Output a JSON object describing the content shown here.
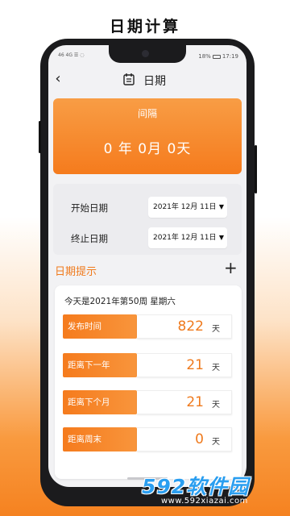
{
  "promo_title": "日期计算",
  "status_bar": {
    "left": "46 4G ☰ ◌",
    "battery": "18%",
    "time": "17:19"
  },
  "header": {
    "title": "日期",
    "back_icon": "back-chevron-icon",
    "title_icon": "calendar-icon"
  },
  "interval": {
    "label": "间隔",
    "value": "0 年 0月 0天"
  },
  "dates": {
    "start_label": "开始日期",
    "start_value": "2021年 12月 11日",
    "end_label": "终止日期",
    "end_value": "2021年 12月 11日"
  },
  "tips": {
    "title": "日期提示",
    "add_icon": "plus-icon",
    "today": "今天是2021年第50周  星期六",
    "items": [
      {
        "label": "发布时间",
        "value": "822",
        "unit": "天"
      },
      {
        "label": "距离下一年",
        "value": "21",
        "unit": "天"
      },
      {
        "label": "距离下个月",
        "value": "21",
        "unit": "天"
      },
      {
        "label": "距离周末",
        "value": "0",
        "unit": "天"
      }
    ]
  },
  "watermark": {
    "logo": "592软件园",
    "url": "www.592xiazai.com"
  },
  "colors": {
    "accent": "#f57b1d",
    "accent_light": "#f89d45",
    "value_text": "#ef7a1d"
  }
}
